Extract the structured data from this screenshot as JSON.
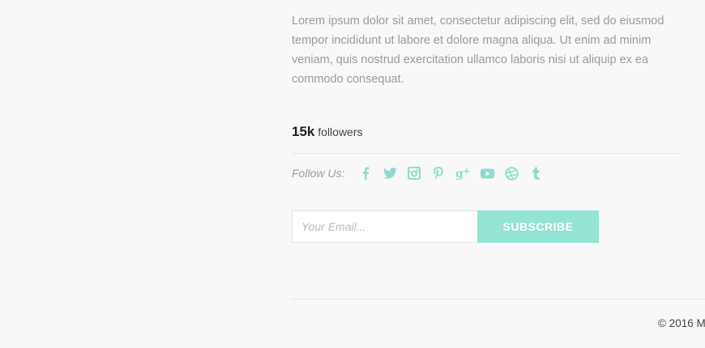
{
  "about": {
    "text": "Lorem ipsum dolor sit amet, consectetur adipiscing elit, sed do eiusmod tempor incididunt ut labore et dolore magna aliqua. Ut enim ad minim veniam, quis nostrud exercitation ullamco laboris nisi ut aliquip ex ea commodo consequat."
  },
  "followers": {
    "count": "15k",
    "label": "followers"
  },
  "follow": {
    "label": "Follow Us:",
    "icon_color": "#8ddccb",
    "icons": [
      "facebook-icon",
      "twitter-icon",
      "instagram-icon",
      "pinterest-icon",
      "google-plus-icon",
      "youtube-icon",
      "dribbble-icon",
      "tumblr-icon"
    ]
  },
  "subscribe": {
    "email_placeholder": "Your Email...",
    "email_value": "",
    "button_label": "SUBSCRIBE",
    "button_color": "#95e3d3"
  },
  "footer": {
    "copyright": "© 2016 M"
  }
}
